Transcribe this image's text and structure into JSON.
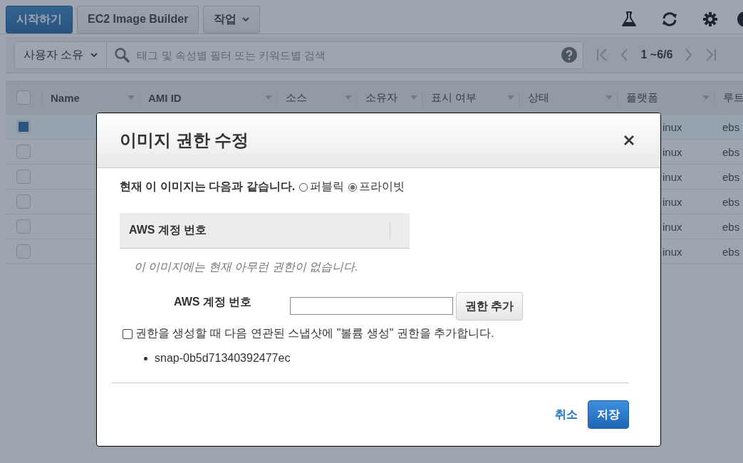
{
  "toolbar": {
    "buttons": [
      {
        "label": "시작하기",
        "kind": "primary"
      },
      {
        "label": "EC2 Image Builder",
        "kind": "default"
      },
      {
        "label": "작업",
        "kind": "menu"
      }
    ]
  },
  "filter": {
    "owner": "사용자 소유",
    "search_placeholder": "태그 및 속성별 필터 또는 키워드별 검색",
    "pagination": "1 ~6/6"
  },
  "table": {
    "select_all_checked": false,
    "columns": [
      "Name",
      "AMI ID",
      "소스",
      "소유자",
      "표시 여부",
      "상태",
      "플랫폼",
      "루트"
    ],
    "rows": [
      {
        "selected": true,
        "platform": "inux",
        "root": "ebs"
      },
      {
        "selected": false,
        "platform": "inux",
        "root": "ebs"
      },
      {
        "selected": false,
        "platform": "inux",
        "root": "ebs"
      },
      {
        "selected": false,
        "platform": "inux",
        "root": "ebs"
      },
      {
        "selected": false,
        "platform": "inux",
        "root": "ebs"
      },
      {
        "selected": false,
        "platform": "inux",
        "root": "ebs"
      }
    ]
  },
  "dialog": {
    "title": "이미지 권한 수정",
    "visibility_label": "현재 이 이미지는 다음과 같습니다.",
    "visibility_options": [
      {
        "label": "퍼블릭",
        "selected": false
      },
      {
        "label": "프라이빗",
        "selected": true
      }
    ],
    "permissions_table": {
      "column": "AWS 계정 번호",
      "empty_message": "이 이미지에는 현재 아무런 권한이 없습니다."
    },
    "account_field": {
      "label": "AWS 계정 번호"
    },
    "add_button": "권한 추가",
    "create_volume": {
      "label": "권한을 생성할 때 다음 연관된 스냅샷에 \"볼륨 생성\" 권한을 추가합니다.",
      "checked": false
    },
    "snapshots": [
      "snap-0b5d71340392477ec"
    ],
    "cancel": "취소",
    "save": "저장"
  }
}
